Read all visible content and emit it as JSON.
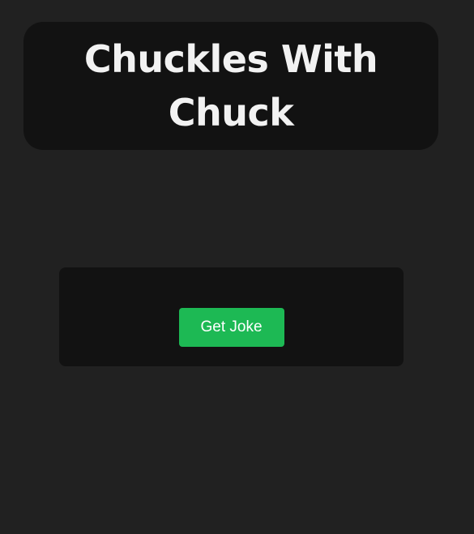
{
  "header": {
    "title": "Chuckles With Chuck"
  },
  "joke_card": {
    "button_label": "Get Joke"
  },
  "colors": {
    "background": "#212121",
    "card": "#121212",
    "accent": "#1db954",
    "title_text": "#f2f2f2"
  }
}
